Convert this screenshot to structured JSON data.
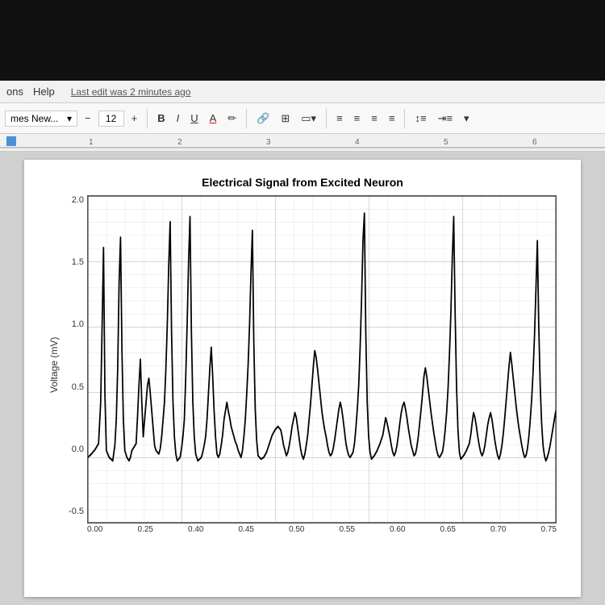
{
  "top_bar": {
    "background": "black"
  },
  "menu_bar": {
    "items": [
      "ons",
      "Help"
    ],
    "last_edit": "Last edit was 2 minutes ago"
  },
  "toolbar": {
    "font_name": "mes New...",
    "font_size": "12",
    "buttons": {
      "bold": "B",
      "italic": "I",
      "underline": "U",
      "font_color": "A",
      "link": "🔗",
      "plus_minus": "±",
      "image": "□",
      "align_left": "≡",
      "align_center": "≡",
      "align_right": "≡",
      "justify": "≡",
      "line_spacing": "↕",
      "indent": "⇥"
    },
    "decrease_size": "−",
    "increase_size": "+"
  },
  "ruler": {
    "marks": [
      "1",
      "2",
      "3",
      "4",
      "5",
      "6"
    ]
  },
  "chart": {
    "title": "Electrical Signal from Excited Neuron",
    "y_axis_label": "Voltage (mV)",
    "y_axis_ticks": [
      "2.0",
      "1.5",
      "1.0",
      "0.5",
      "0.0",
      "-0.5"
    ],
    "x_axis_ticks": [
      "0.00",
      "0.25",
      "0.40",
      "0.45",
      "0.50",
      "0.55",
      "0.60",
      "0.65",
      "0.70",
      "0.75"
    ],
    "colors": {
      "grid": "#c0c0c0",
      "line": "#000000",
      "background": "#ffffff"
    }
  }
}
